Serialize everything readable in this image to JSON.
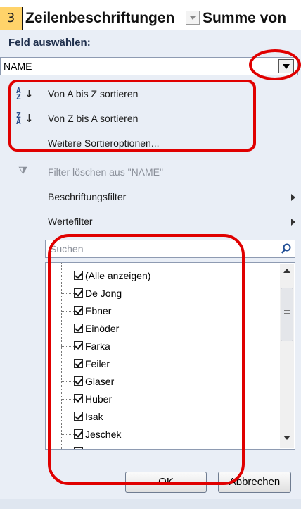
{
  "header": {
    "row_number": "3",
    "column_a": "Zeilenbeschriftungen",
    "column_b": "Summe von"
  },
  "field_select": {
    "label": "Feld auswählen:",
    "value": "NAME"
  },
  "menu": {
    "sort_az": "Von A bis Z sortieren",
    "sort_za": "Von Z bis A sortieren",
    "more_sort": "Weitere Sortieroptionen...",
    "clear_filter": "Filter löschen aus \"NAME\"",
    "label_filter": "Beschriftungsfilter",
    "value_filter": "Wertefilter"
  },
  "search": {
    "placeholder": "Suchen"
  },
  "items": [
    "(Alle anzeigen)",
    "De Jong",
    "Ebner",
    "Einöder",
    "Farka",
    "Feiler",
    "Glaser",
    "Huber",
    "Isak",
    "Jeschek"
  ],
  "buttons": {
    "ok": "OK",
    "cancel": "Abbrechen"
  },
  "icons": {
    "sort_asc": "sort-a-z-icon",
    "sort_desc": "sort-z-a-icon",
    "filter_clear": "filter-clear-icon",
    "search": "search-icon"
  },
  "colors": {
    "annotation": "#e00000",
    "panel": "#e9eef6",
    "header_highlight": "#ffd36a"
  }
}
